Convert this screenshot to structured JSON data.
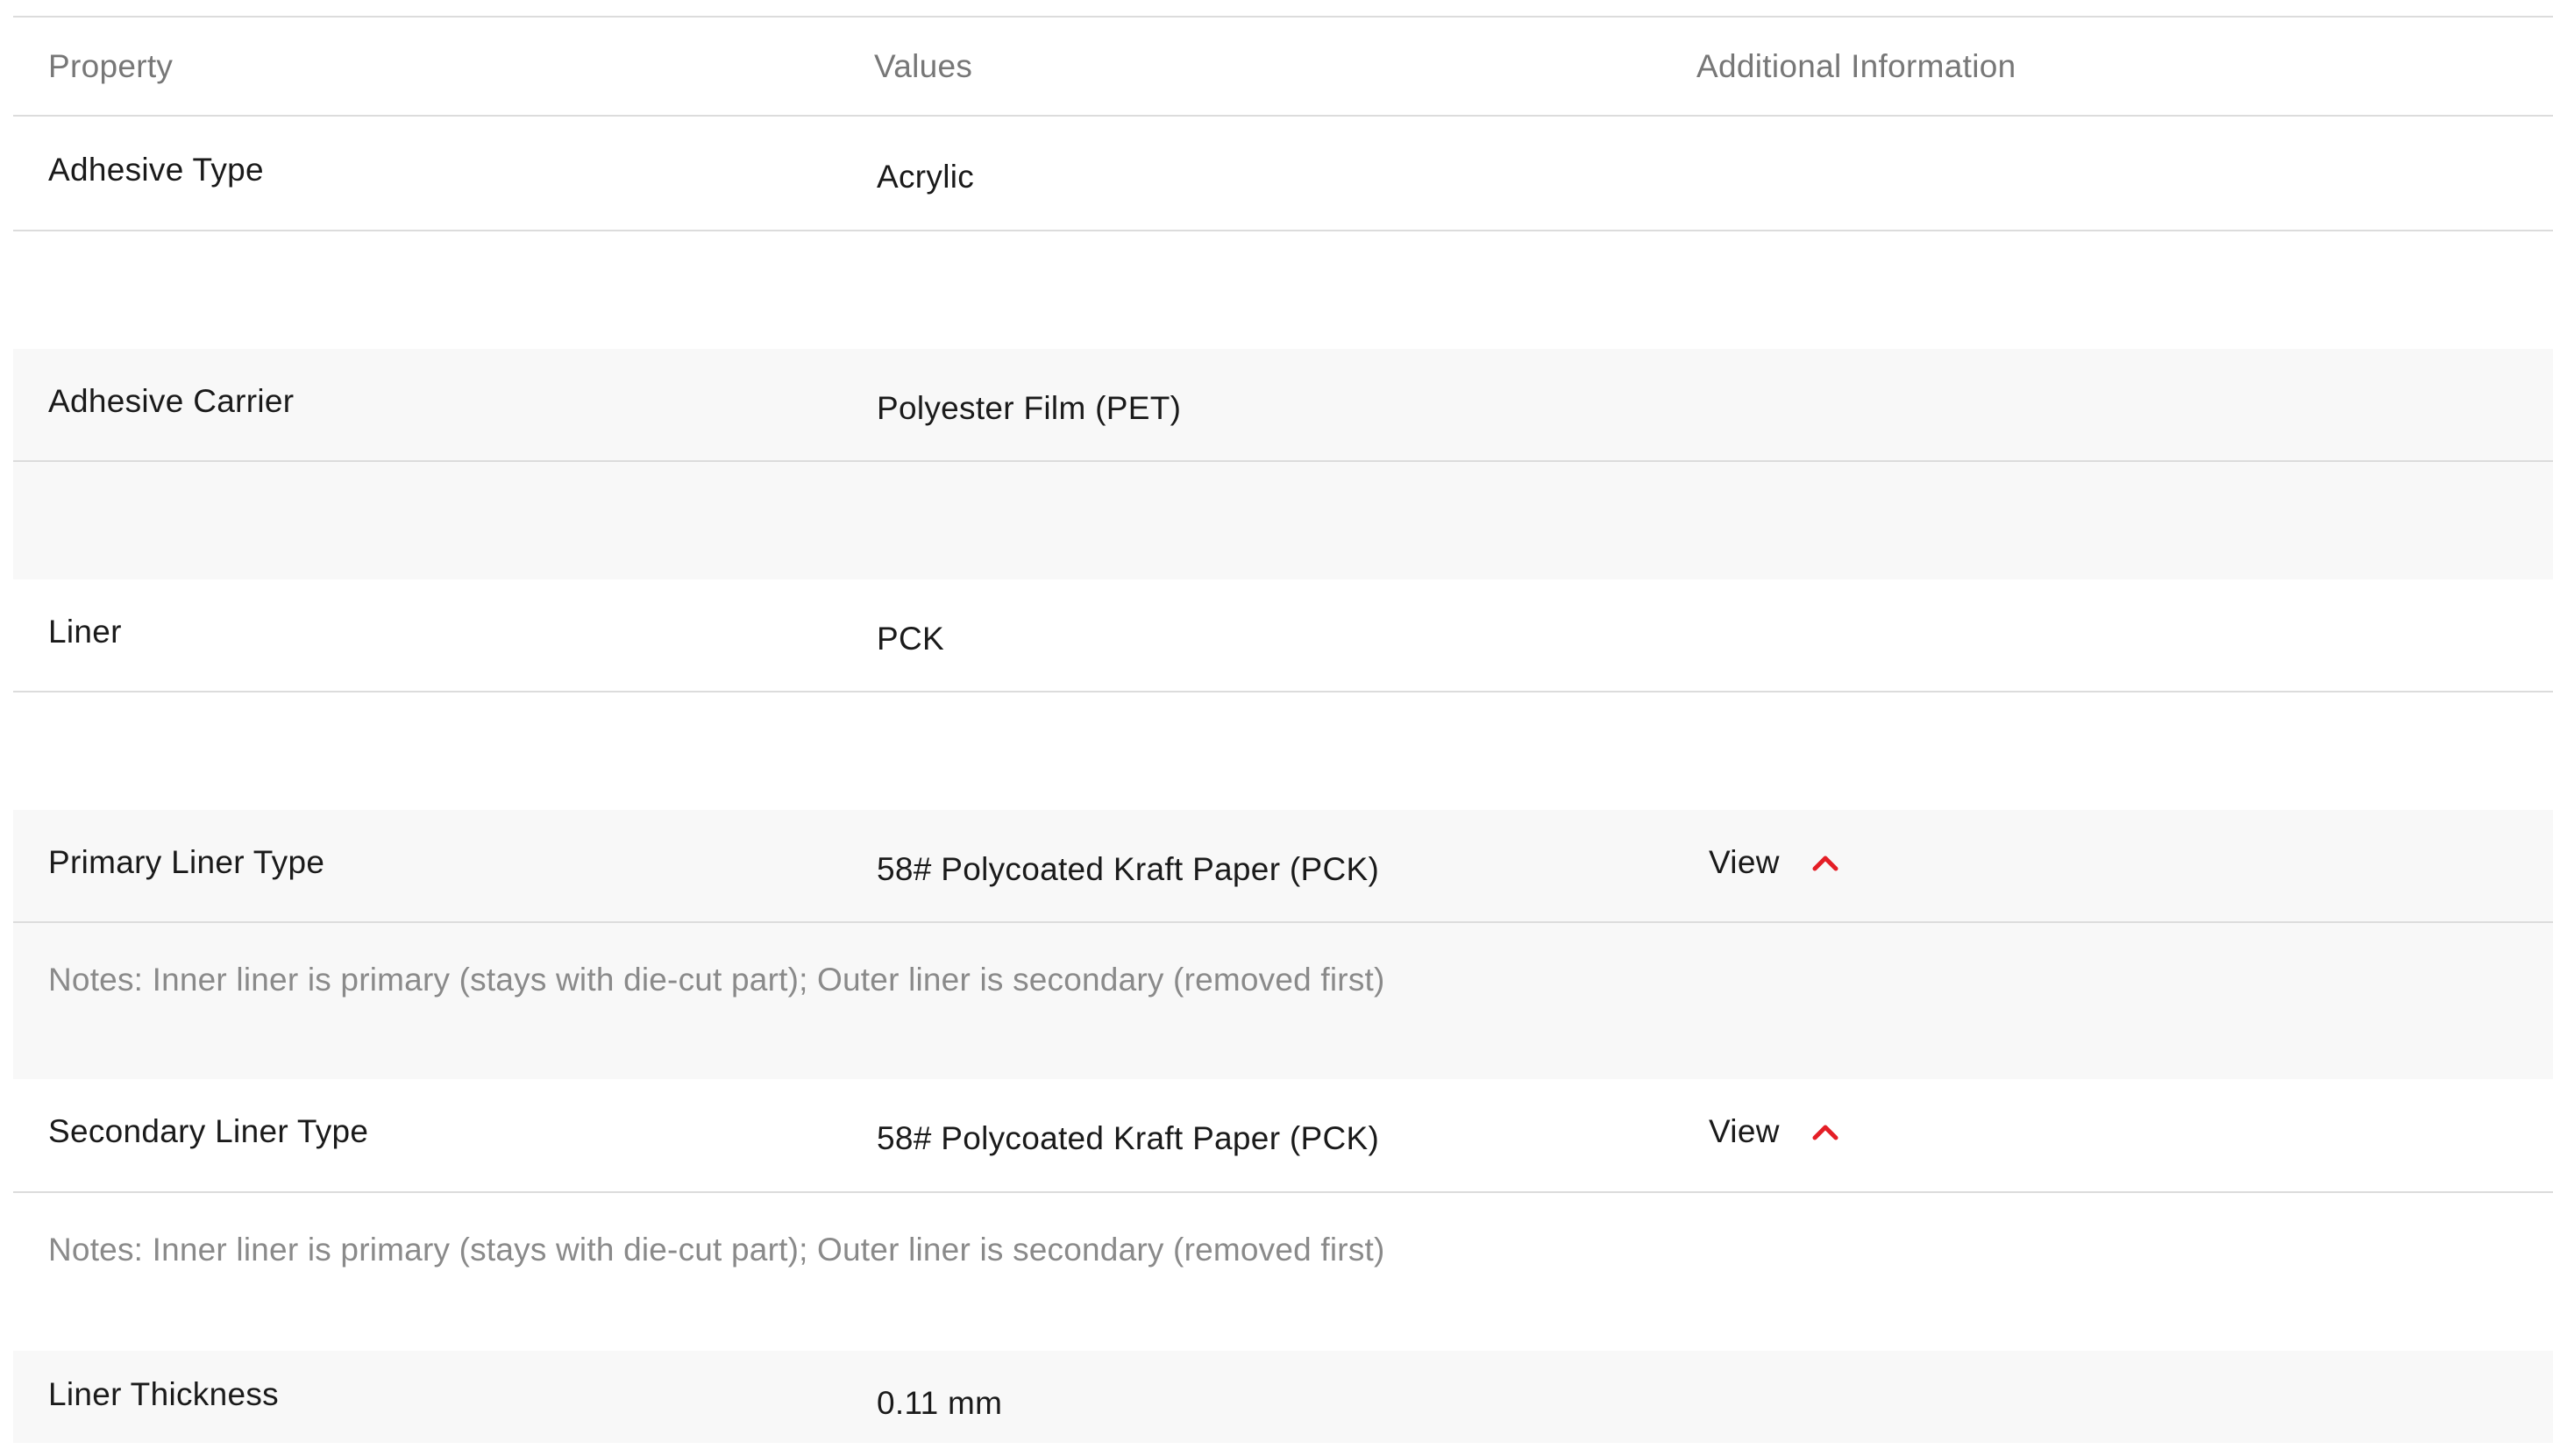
{
  "header": {
    "property": "Property",
    "values": "Values",
    "additional": "Additional Information"
  },
  "rows": [
    {
      "property": "Adhesive Type",
      "value": "Acrylic"
    },
    {
      "property": "Adhesive Carrier",
      "value": "Polyester Film (PET)"
    },
    {
      "property": "Liner",
      "value": "PCK"
    },
    {
      "property": "Primary Liner Type",
      "value": "58# Polycoated Kraft Paper (PCK)",
      "view_label": "View",
      "notes": "Notes: Inner liner is primary (stays with die-cut part); Outer liner is secondary (removed first)"
    },
    {
      "property": "Secondary Liner Type",
      "value": "58# Polycoated Kraft Paper (PCK)",
      "view_label": "View",
      "notes": "Notes: Inner liner is primary (stays with die-cut part); Outer liner is secondary (removed first)"
    },
    {
      "property": "Liner Thickness",
      "value": "0.11 mm"
    }
  ],
  "colors": {
    "accent": "#e41e26",
    "border": "#dcdcdc",
    "row_alt": "#f8f8f8",
    "header_text": "#777777",
    "notes_text": "#8a8a8a"
  },
  "icons": {
    "expand_toggle": "chevron-up-icon"
  }
}
